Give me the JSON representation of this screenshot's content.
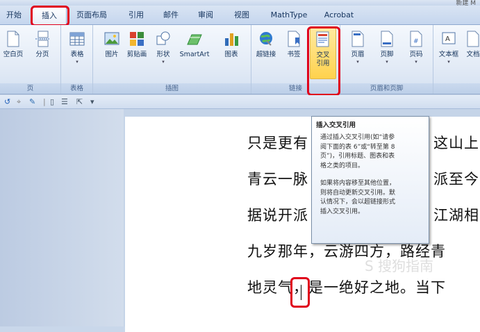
{
  "window": {
    "title_fragment": "新建 M"
  },
  "tabs": [
    "开始",
    "插入",
    "页面布局",
    "引用",
    "邮件",
    "审阅",
    "视图",
    "MathType",
    "Acrobat"
  ],
  "active_tab": "插入",
  "ribbon": {
    "page_group": {
      "label": "页",
      "buttons": [
        "空白页",
        "分页"
      ]
    },
    "table_group": {
      "label": "表格",
      "buttons": [
        "表格"
      ]
    },
    "illustration_group": {
      "label": "插图",
      "buttons": [
        "图片",
        "剪贴画",
        "形状",
        "SmartArt",
        "图表"
      ]
    },
    "link_group": {
      "label": "链接",
      "buttons": [
        "超链接",
        "书签",
        "交叉\n引用"
      ]
    },
    "header_footer_group": {
      "label": "页眉和页脚",
      "buttons": [
        "页眉",
        "页脚",
        "页码"
      ]
    },
    "text_group": {
      "buttons": [
        "文本框",
        "文档"
      ]
    }
  },
  "tooltip": {
    "title": "插入交叉引用",
    "para1_lines": [
      "通过插入交叉引用(如“请参",
      "阅下面的表 6”或“转至第 8",
      "页”)，引用标题、图表和表",
      "格之类的项目。"
    ],
    "para2_lines": [
      "如果将内容移至其他位置，",
      "则将自动更新交叉引用。默",
      "认情况下，会以超链接形式",
      "插入交叉引用。"
    ]
  },
  "document": {
    "lines": [
      {
        "left": "只是更有",
        "right": "这山上"
      },
      {
        "left": "青云一脉",
        "right": "派至今"
      },
      {
        "left": "据说开派",
        "right": "江湖相"
      },
      {
        "left": "九岁那年，云游四方，路经青",
        "right": ""
      },
      {
        "left": "地灵气",
        "right": "，是一绝好之地。当下"
      }
    ]
  },
  "watermark": "S 搜狗指南",
  "colors": {
    "highlight_red": "#e0001b",
    "ribbon_bg": "#e3ebf6",
    "button_hover": "#ffd24d"
  }
}
